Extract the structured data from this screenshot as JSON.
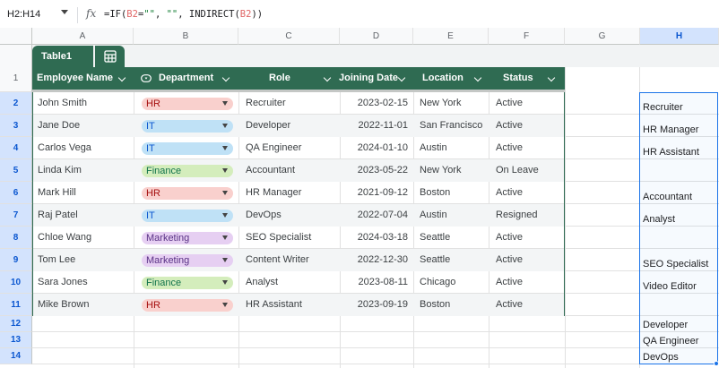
{
  "formula_bar": {
    "name_box": "H2:H14",
    "fx": "fx",
    "formula_parts": [
      "=IF(",
      "B2",
      "=",
      "\"\"",
      ", ",
      "\"\"",
      ", INDIRECT(",
      "B2",
      "))"
    ]
  },
  "columns": [
    "A",
    "B",
    "C",
    "D",
    "E",
    "F",
    "G",
    "H"
  ],
  "rows": [
    "1",
    "2",
    "3",
    "4",
    "5",
    "6",
    "7",
    "8",
    "9",
    "10",
    "11",
    "12",
    "13",
    "14"
  ],
  "table": {
    "name": "Table1",
    "headers": [
      "Employee Name",
      "Department",
      "Role",
      "Joining Date",
      "Location",
      "Status"
    ],
    "rows": [
      {
        "name": "John Smith",
        "dept": "HR",
        "role": "Recruiter",
        "date": "2023-02-15",
        "loc": "New York",
        "status": "Active"
      },
      {
        "name": "Jane Doe",
        "dept": "IT",
        "role": "Developer",
        "date": "2022-11-01",
        "loc": "San Francisco",
        "status": "Active"
      },
      {
        "name": "Carlos Vega",
        "dept": "IT",
        "role": "QA Engineer",
        "date": "2024-01-10",
        "loc": "Austin",
        "status": "Active"
      },
      {
        "name": "Linda Kim",
        "dept": "Finance",
        "role": "Accountant",
        "date": "2023-05-22",
        "loc": "New York",
        "status": "On Leave"
      },
      {
        "name": "Mark Hill",
        "dept": "HR",
        "role": "HR Manager",
        "date": "2021-09-12",
        "loc": "Boston",
        "status": "Active"
      },
      {
        "name": "Raj Patel",
        "dept": "IT",
        "role": "DevOps",
        "date": "2022-07-04",
        "loc": "Austin",
        "status": "Resigned"
      },
      {
        "name": "Chloe Wang",
        "dept": "Marketing",
        "role": "SEO Specialist",
        "date": "2024-03-18",
        "loc": "Seattle",
        "status": "Active"
      },
      {
        "name": "Tom Lee",
        "dept": "Marketing",
        "role": "Content Writer",
        "date": "2022-12-30",
        "loc": "Seattle",
        "status": "Active"
      },
      {
        "name": "Sara Jones",
        "dept": "Finance",
        "role": "Analyst",
        "date": "2023-08-11",
        "loc": "Chicago",
        "status": "Active"
      },
      {
        "name": "Mike Brown",
        "dept": "HR",
        "role": "HR Assistant",
        "date": "2023-09-19",
        "loc": "Boston",
        "status": "Active"
      }
    ]
  },
  "dept_chip_colors": {
    "HR": {
      "bg": "#f9d0cd",
      "fg": "#a50e0e"
    },
    "IT": {
      "bg": "#bfe1f6",
      "fg": "#0b57d0"
    },
    "Finance": {
      "bg": "#d4edbc",
      "fg": "#11734b"
    },
    "Marketing": {
      "bg": "#e6cff2",
      "fg": "#5a3286"
    }
  },
  "column_h": {
    "row2": "Recruiter",
    "row3": "HR Manager",
    "row4": "HR Assistant",
    "row5": "",
    "row6": "Accountant",
    "row7": "Analyst",
    "row8": "",
    "row9": "SEO Specialist",
    "row10": "Video Editor",
    "row11": "",
    "row12": "Developer",
    "row13": "QA Engineer",
    "row14": "DevOps"
  },
  "accent_color": "#2f6b52",
  "selection_color": "#1a73e8"
}
